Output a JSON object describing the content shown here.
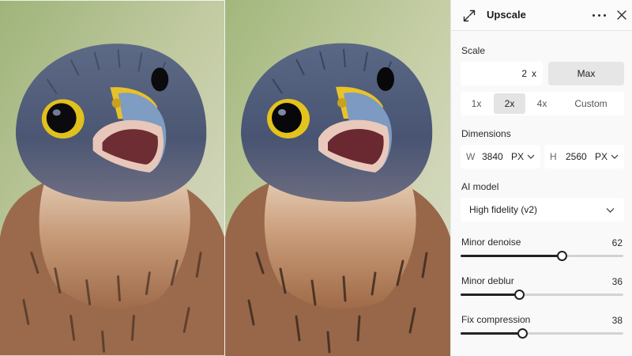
{
  "panel": {
    "title": "Upscale",
    "header_icon": "expand-arrows-icon",
    "more_icon": "more-horizontal-icon",
    "close_icon": "close-icon"
  },
  "scale": {
    "label": "Scale",
    "value": "2",
    "unit": "x",
    "max_label": "Max",
    "options": [
      "1x",
      "2x",
      "4x",
      "Custom"
    ],
    "selected": "2x"
  },
  "dimensions": {
    "label": "Dimensions",
    "width": {
      "label": "W",
      "value": "3840",
      "unit": "PX"
    },
    "height": {
      "label": "H",
      "value": "2560",
      "unit": "PX"
    }
  },
  "ai_model": {
    "label": "AI model",
    "selected": "High fidelity (v2)"
  },
  "sliders": [
    {
      "label": "Minor denoise",
      "value": "62",
      "fraction": 0.62
    },
    {
      "label": "Minor deblur",
      "value": "36",
      "fraction": 0.36
    },
    {
      "label": "Fix compression",
      "value": "38",
      "fraction": 0.38
    }
  ],
  "colors": {
    "accent": "#222222",
    "track": "#d3d3d3",
    "panel_bg": "#f9f9f9"
  }
}
